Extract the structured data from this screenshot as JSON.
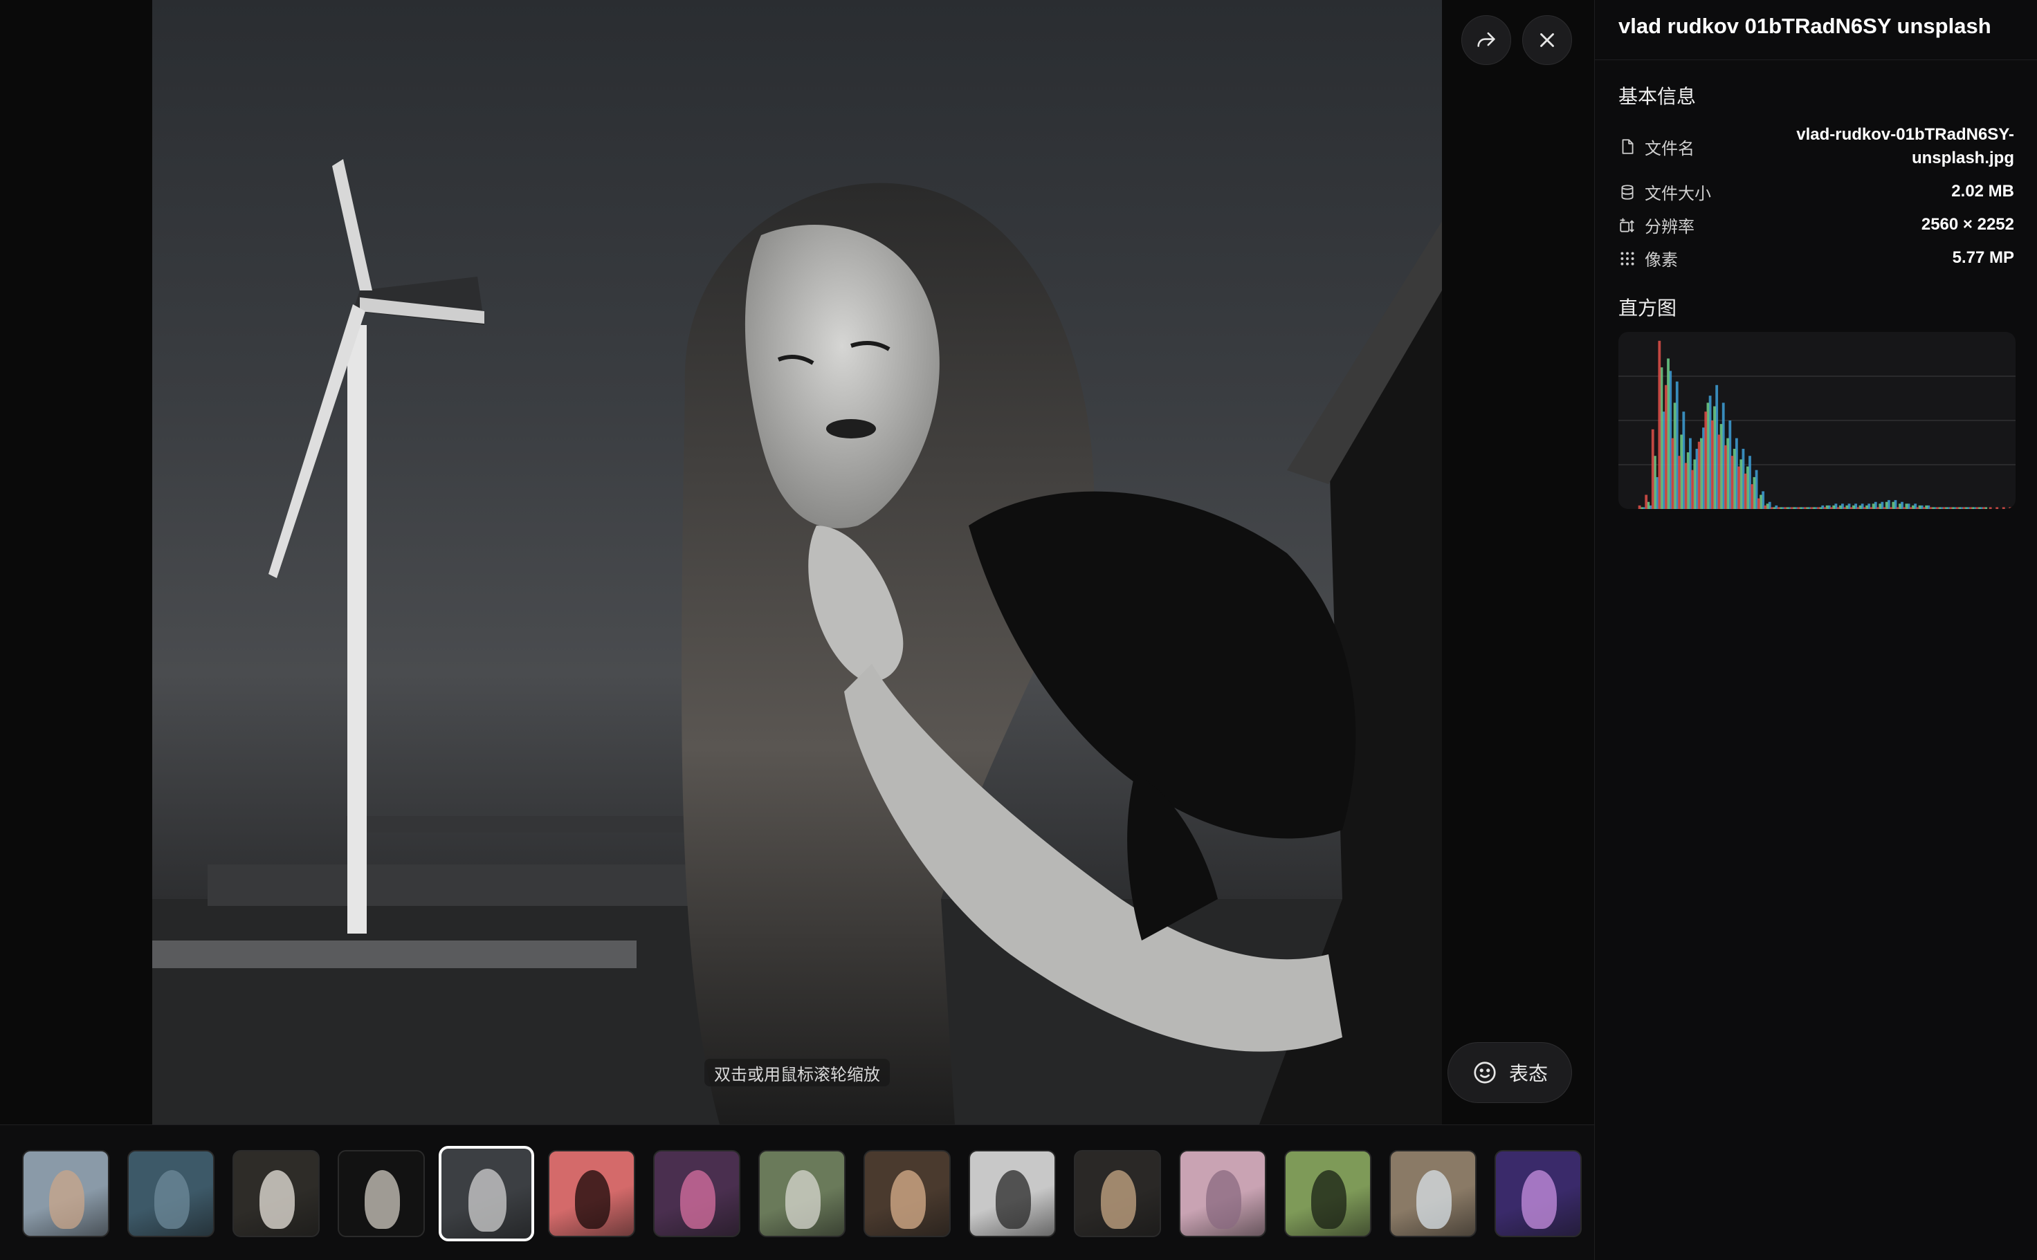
{
  "viewer": {
    "hint": "双击或用鼠标滚轮缩放",
    "react_label": "表态"
  },
  "icons": {
    "share": "share-icon",
    "close": "close-icon",
    "smile": "smile-icon",
    "file": "file-icon",
    "database": "database-icon",
    "resolution": "resolution-icon",
    "pixels": "grid-icon"
  },
  "panel": {
    "title": "vlad rudkov 01bTRadN6SY unsplash",
    "basic_info_title": "基本信息",
    "rows": [
      {
        "key": "文件名",
        "value_line1": "vlad-rudkov-01bTRadN6SY-",
        "value_line2": "unsplash.jpg"
      },
      {
        "key": "文件大小",
        "value": "2.02 MB"
      },
      {
        "key": "分辨率",
        "value": "2560 × 2252"
      },
      {
        "key": "像素",
        "value": "5.77 MP"
      }
    ],
    "histogram_title": "直方图"
  },
  "thumbnails": [
    {
      "name": "portrait-woman-denim",
      "bg": "#8a9aa8",
      "fg": "#c9a58a",
      "active": false
    },
    {
      "name": "ocean-waves",
      "bg": "#3d5968",
      "fg": "#6e8a99",
      "active": false
    },
    {
      "name": "table-still-life",
      "bg": "#2e2c28",
      "fg": "#e9e4dc",
      "active": false
    },
    {
      "name": "champagne-glass",
      "bg": "#121212",
      "fg": "#cfcac0",
      "active": false
    },
    {
      "name": "woman-windmill-bw",
      "bg": "#3c3f43",
      "fg": "#d0d0d0",
      "active": true
    },
    {
      "name": "red-abstract-curve",
      "bg": "#d46a6a",
      "fg": "#1a0a0a",
      "active": false
    },
    {
      "name": "neon-street-night",
      "bg": "#4a2f4f",
      "fg": "#d870a0",
      "active": false
    },
    {
      "name": "woman-in-field",
      "bg": "#6a7a5a",
      "fg": "#d8d8d0",
      "active": false
    },
    {
      "name": "blonde-portrait",
      "bg": "#4a3a2e",
      "fg": "#d9b08c",
      "active": false
    },
    {
      "name": "woman-lying-bw",
      "bg": "#c8c8c8",
      "fg": "#2a2a2a",
      "active": false
    },
    {
      "name": "woman-black-hat",
      "bg": "#2a2826",
      "fg": "#c8a886",
      "active": false
    },
    {
      "name": "pink-clouds",
      "bg": "#c9a3b3",
      "fg": "#8a6a80",
      "active": false
    },
    {
      "name": "green-creature",
      "bg": "#7e9a58",
      "fg": "#1a2014",
      "active": false
    },
    {
      "name": "dried-flowers-card",
      "bg": "#8a7a66",
      "fg": "#d8e2e8",
      "active": false
    },
    {
      "name": "purple-neon-figure",
      "bg": "#3a2a6a",
      "fg": "#c890e0",
      "active": false
    }
  ],
  "histogram": {
    "red": [
      0,
      0,
      0,
      2,
      8,
      45,
      95,
      70,
      40,
      30,
      26,
      22,
      38,
      55,
      50,
      42,
      36,
      30,
      24,
      20,
      14,
      6,
      2,
      1,
      1,
      1,
      1,
      1,
      1,
      1,
      1,
      1,
      1,
      1,
      1,
      1,
      1,
      1,
      1,
      1,
      1,
      1,
      1,
      1,
      1,
      1,
      1,
      1,
      1,
      1,
      1,
      1,
      1,
      1,
      1,
      1,
      1,
      1,
      1,
      1
    ],
    "green": [
      0,
      0,
      0,
      1,
      4,
      30,
      80,
      85,
      60,
      42,
      32,
      28,
      40,
      60,
      58,
      48,
      40,
      34,
      28,
      24,
      18,
      8,
      3,
      1,
      1,
      1,
      1,
      1,
      1,
      1,
      1,
      2,
      2,
      2,
      2,
      2,
      2,
      2,
      3,
      3,
      4,
      4,
      3,
      3,
      2,
      2,
      2,
      1,
      1,
      1,
      1,
      1,
      1,
      1,
      1,
      1,
      0,
      0,
      0,
      0
    ],
    "blue": [
      0,
      0,
      0,
      1,
      2,
      18,
      55,
      78,
      72,
      55,
      40,
      34,
      46,
      64,
      70,
      60,
      50,
      40,
      34,
      30,
      22,
      10,
      4,
      2,
      1,
      1,
      1,
      1,
      1,
      1,
      2,
      2,
      3,
      3,
      3,
      3,
      3,
      3,
      4,
      4,
      5,
      5,
      4,
      3,
      3,
      2,
      2,
      1,
      1,
      1,
      1,
      1,
      1,
      1,
      1,
      0,
      0,
      0,
      0,
      0
    ]
  }
}
